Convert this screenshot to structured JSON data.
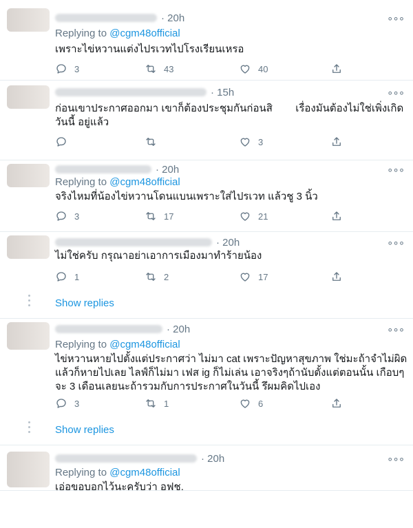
{
  "replying_prefix": "Replying to",
  "more_glyph": "∘∘∘",
  "show_replies_label": "Show replies",
  "tweets": [
    {
      "time": "· 20h",
      "reply_to": "@cgm48official",
      "text": "เพราะไข่หวานแต่งไปรเวทไปโรงเรียนเหรอ",
      "replies": "3",
      "retweets": "43",
      "likes": "40"
    },
    {
      "time": "· 15h",
      "reply_to": "",
      "text": "ก่อนเขาประกาศออกมา เขาก็ต้องประชุมกันก่อนสิ        เรื่องมันต้องไม่ใช่เพิ่งเกิดวันนี้ อยู่แล้ว",
      "replies": "",
      "retweets": "",
      "likes": "3"
    },
    {
      "time": "· 20h",
      "reply_to": "@cgm48official",
      "text": "จริงไหมที่น้องไข่หวานโดนแบนเพราะใส่ไปรเวท แล้วชู 3 นิ้ว",
      "replies": "3",
      "retweets": "17",
      "likes": "21"
    },
    {
      "time": "· 20h",
      "reply_to": "",
      "text": "ไม่ใช่ครับ กรุณาอย่าเอาการเมืองมาทำร้ายน้อง",
      "replies": "1",
      "retweets": "2",
      "likes": "17"
    },
    {
      "time": "· 20h",
      "reply_to": "@cgm48official",
      "text": "ไข่หวานหายไปตั้งแต่ประกาศว่า ไม่มา cat เพราะปัญหาสุขภาพ ใช่มะถ้าจำไม่ผิด แล้วก็หายไปเลย ไลฟ์ก็ไม่มา เฟส ig ก็ไม่เล่น เอาจริงๆถ้านับตั้งแต่ตอนนั้น เกือบๆจะ 3 เดือนเลยนะถ้ารวมกับการประกาศในวันนี้ รึผมคิดไปเอง",
      "replies": "3",
      "retweets": "1",
      "likes": "6"
    },
    {
      "time": "· 20h",
      "reply_to": "@cgm48official",
      "text": "เอ่อขอบอกไว้นะครับว่า อฟช.",
      "replies": "",
      "retweets": "",
      "likes": ""
    }
  ]
}
